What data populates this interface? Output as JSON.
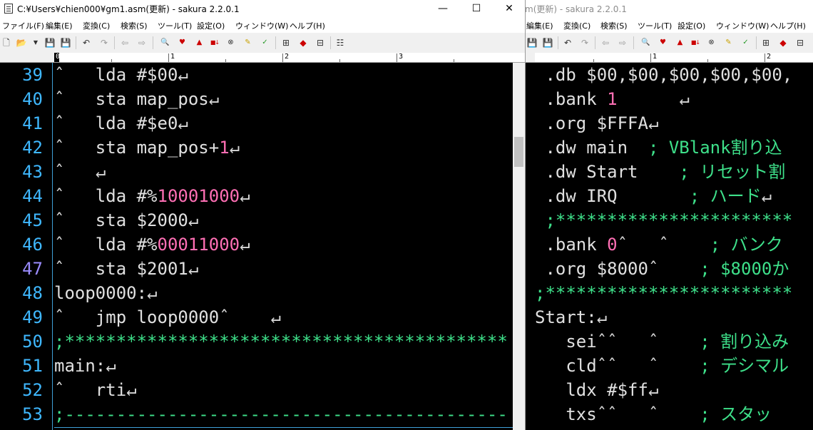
{
  "left_window": {
    "title": "C:¥Users¥chien000¥gm1.asm(更新) - sakura 2.2.0.1",
    "controls": {
      "minimize": "—",
      "maximize": "☐",
      "close": "✕"
    },
    "menu": [
      "ファイル(F)",
      "編集(E)",
      "変換(C)",
      "検索(S)",
      "ツール(T)",
      "設定(O)",
      "ウィンドウ(W)",
      "ヘルプ(H)"
    ],
    "ruler": [
      "0",
      "1",
      "2",
      "3"
    ],
    "lines": [
      {
        "num": "39",
        "parts": [
          {
            "t": "ˆ",
            "c": "mark"
          },
          {
            "t": "   lda #$00"
          },
          {
            "t": "↵",
            "c": "mark"
          }
        ]
      },
      {
        "num": "40",
        "parts": [
          {
            "t": "ˆ",
            "c": "mark"
          },
          {
            "t": "   sta map_pos"
          },
          {
            "t": "↵",
            "c": "mark"
          }
        ]
      },
      {
        "num": "41",
        "parts": [
          {
            "t": "ˆ",
            "c": "mark"
          },
          {
            "t": "   lda #$e0"
          },
          {
            "t": "↵",
            "c": "mark"
          }
        ]
      },
      {
        "num": "42",
        "parts": [
          {
            "t": "ˆ",
            "c": "mark"
          },
          {
            "t": "   sta map_pos+"
          },
          {
            "t": "1",
            "c": "pink"
          },
          {
            "t": "↵",
            "c": "mark"
          }
        ]
      },
      {
        "num": "43",
        "parts": [
          {
            "t": "ˆ",
            "c": "mark"
          },
          {
            "t": "   "
          },
          {
            "t": "↵",
            "c": "mark"
          }
        ]
      },
      {
        "num": "44",
        "parts": [
          {
            "t": "ˆ",
            "c": "mark"
          },
          {
            "t": "   lda #%"
          },
          {
            "t": "10001000",
            "c": "pink"
          },
          {
            "t": "↵",
            "c": "mark"
          }
        ]
      },
      {
        "num": "45",
        "parts": [
          {
            "t": "ˆ",
            "c": "mark"
          },
          {
            "t": "   sta $2000"
          },
          {
            "t": "↵",
            "c": "mark"
          }
        ]
      },
      {
        "num": "46",
        "parts": [
          {
            "t": "ˆ",
            "c": "mark"
          },
          {
            "t": "   lda #%"
          },
          {
            "t": "00011000",
            "c": "pink"
          },
          {
            "t": "↵",
            "c": "mark"
          }
        ]
      },
      {
        "num": "47",
        "cur": true,
        "parts": [
          {
            "t": "ˆ",
            "c": "mark"
          },
          {
            "t": "   sta $2001"
          },
          {
            "t": "↵",
            "c": "mark"
          }
        ]
      },
      {
        "num": "48",
        "parts": [
          {
            "t": "loop0000:"
          },
          {
            "t": "↵",
            "c": "mark"
          }
        ]
      },
      {
        "num": "49",
        "parts": [
          {
            "t": "ˆ",
            "c": "mark"
          },
          {
            "t": "   jmp loop0000"
          },
          {
            "t": "ˆ",
            "c": "mark"
          },
          {
            "t": "    "
          },
          {
            "t": "↵",
            "c": "mark"
          }
        ]
      },
      {
        "num": "50",
        "parts": [
          {
            "t": ";*******************************************",
            "c": "green"
          }
        ]
      },
      {
        "num": "51",
        "parts": [
          {
            "t": "main:"
          },
          {
            "t": "↵",
            "c": "mark"
          }
        ]
      },
      {
        "num": "52",
        "parts": [
          {
            "t": "ˆ",
            "c": "mark"
          },
          {
            "t": "   rti"
          },
          {
            "t": "↵",
            "c": "mark"
          }
        ]
      },
      {
        "num": "53",
        "parts": [
          {
            "t": ";-------------------------------------------",
            "c": "green"
          }
        ]
      }
    ]
  },
  "right_window": {
    "title": "m(更新) - sakura 2.2.0.1",
    "menu": [
      "編集(E)",
      "変換(C)",
      "検索(S)",
      "ツール(T)",
      "設定(O)",
      "ウィンドウ(W)",
      "ヘルプ(H)"
    ],
    "ruler": [
      "1",
      "2"
    ],
    "lines": [
      {
        "parts": [
          {
            "t": " .db $00,$00,$00,$00,$00,"
          }
        ]
      },
      {
        "parts": [
          {
            "t": " .bank "
          },
          {
            "t": "1",
            "c": "pink"
          },
          {
            "t": "      "
          },
          {
            "t": "↵",
            "c": "mark"
          }
        ]
      },
      {
        "parts": [
          {
            "t": " .org $FFFA"
          },
          {
            "t": "↵",
            "c": "mark"
          }
        ]
      },
      {
        "parts": [
          {
            "t": " .dw main  "
          },
          {
            "t": "; VBlank割り込",
            "c": "green"
          }
        ]
      },
      {
        "parts": [
          {
            "t": " .dw Start    "
          },
          {
            "t": "; リセット割",
            "c": "green"
          }
        ]
      },
      {
        "parts": [
          {
            "t": " .dw IRQ       "
          },
          {
            "t": "; ハード",
            "c": "green"
          },
          {
            "t": "↵",
            "c": "mark"
          }
        ]
      },
      {
        "parts": [
          {
            "t": " ;***********************",
            "c": "green"
          }
        ]
      },
      {
        "parts": [
          {
            "t": " .bank "
          },
          {
            "t": "0",
            "c": "pink"
          },
          {
            "t": "ˆ",
            "c": "mark"
          },
          {
            "t": "   "
          },
          {
            "t": "ˆ",
            "c": "mark"
          },
          {
            "t": "    "
          },
          {
            "t": "; バンク",
            "c": "green"
          }
        ]
      },
      {
        "parts": [
          {
            "t": " .org $8000"
          },
          {
            "t": "ˆ",
            "c": "mark"
          },
          {
            "t": "    "
          },
          {
            "t": "; $8000か",
            "c": "green"
          }
        ]
      },
      {
        "parts": [
          {
            "t": ";************************",
            "c": "green"
          }
        ]
      },
      {
        "parts": [
          {
            "t": "Start:"
          },
          {
            "t": "↵",
            "c": "mark"
          }
        ]
      },
      {
        "parts": [
          {
            "t": "   sei"
          },
          {
            "t": "ˆˆ",
            "c": "mark"
          },
          {
            "t": "   "
          },
          {
            "t": "ˆ",
            "c": "mark"
          },
          {
            "t": "    "
          },
          {
            "t": "; 割り込み",
            "c": "green"
          }
        ]
      },
      {
        "parts": [
          {
            "t": "   cld"
          },
          {
            "t": "ˆˆ",
            "c": "mark"
          },
          {
            "t": "   "
          },
          {
            "t": "ˆ",
            "c": "mark"
          },
          {
            "t": "    "
          },
          {
            "t": "; デシマル",
            "c": "green"
          }
        ]
      },
      {
        "parts": [
          {
            "t": "   ldx #$ff"
          },
          {
            "t": "↵",
            "c": "mark"
          }
        ]
      },
      {
        "parts": [
          {
            "t": "   txs"
          },
          {
            "t": "ˆˆ",
            "c": "mark"
          },
          {
            "t": "   "
          },
          {
            "t": "ˆ",
            "c": "mark"
          },
          {
            "t": "    "
          },
          {
            "t": "; スタッ",
            "c": "green"
          }
        ]
      }
    ]
  },
  "toolbar_icons": [
    "new-file",
    "open-file",
    "dropdown",
    "save",
    "save-all",
    "undo",
    "redo",
    "back",
    "forward",
    "search-prev",
    "search-next",
    "search-a",
    "search-b",
    "search-c",
    "search-d",
    "search-e",
    "bookmark",
    "grep",
    "outline",
    "compare"
  ]
}
